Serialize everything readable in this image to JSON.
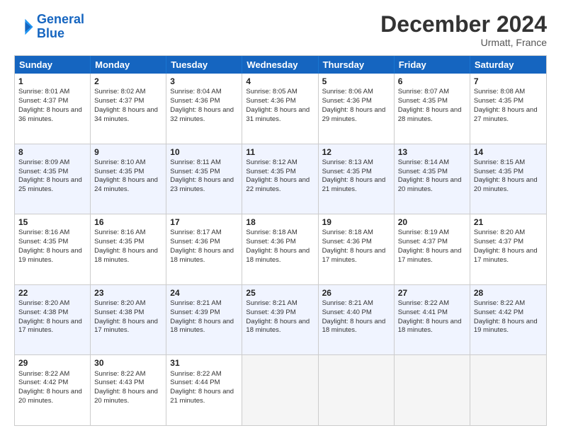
{
  "header": {
    "logo_line1": "General",
    "logo_line2": "Blue",
    "month_title": "December 2024",
    "location": "Urmatt, France"
  },
  "days_of_week": [
    "Sunday",
    "Monday",
    "Tuesday",
    "Wednesday",
    "Thursday",
    "Friday",
    "Saturday"
  ],
  "rows": [
    [
      {
        "day": "1",
        "sunrise": "Sunrise: 8:01 AM",
        "sunset": "Sunset: 4:37 PM",
        "daylight": "Daylight: 8 hours and 36 minutes."
      },
      {
        "day": "2",
        "sunrise": "Sunrise: 8:02 AM",
        "sunset": "Sunset: 4:37 PM",
        "daylight": "Daylight: 8 hours and 34 minutes."
      },
      {
        "day": "3",
        "sunrise": "Sunrise: 8:04 AM",
        "sunset": "Sunset: 4:36 PM",
        "daylight": "Daylight: 8 hours and 32 minutes."
      },
      {
        "day": "4",
        "sunrise": "Sunrise: 8:05 AM",
        "sunset": "Sunset: 4:36 PM",
        "daylight": "Daylight: 8 hours and 31 minutes."
      },
      {
        "day": "5",
        "sunrise": "Sunrise: 8:06 AM",
        "sunset": "Sunset: 4:36 PM",
        "daylight": "Daylight: 8 hours and 29 minutes."
      },
      {
        "day": "6",
        "sunrise": "Sunrise: 8:07 AM",
        "sunset": "Sunset: 4:35 PM",
        "daylight": "Daylight: 8 hours and 28 minutes."
      },
      {
        "day": "7",
        "sunrise": "Sunrise: 8:08 AM",
        "sunset": "Sunset: 4:35 PM",
        "daylight": "Daylight: 8 hours and 27 minutes."
      }
    ],
    [
      {
        "day": "8",
        "sunrise": "Sunrise: 8:09 AM",
        "sunset": "Sunset: 4:35 PM",
        "daylight": "Daylight: 8 hours and 25 minutes."
      },
      {
        "day": "9",
        "sunrise": "Sunrise: 8:10 AM",
        "sunset": "Sunset: 4:35 PM",
        "daylight": "Daylight: 8 hours and 24 minutes."
      },
      {
        "day": "10",
        "sunrise": "Sunrise: 8:11 AM",
        "sunset": "Sunset: 4:35 PM",
        "daylight": "Daylight: 8 hours and 23 minutes."
      },
      {
        "day": "11",
        "sunrise": "Sunrise: 8:12 AM",
        "sunset": "Sunset: 4:35 PM",
        "daylight": "Daylight: 8 hours and 22 minutes."
      },
      {
        "day": "12",
        "sunrise": "Sunrise: 8:13 AM",
        "sunset": "Sunset: 4:35 PM",
        "daylight": "Daylight: 8 hours and 21 minutes."
      },
      {
        "day": "13",
        "sunrise": "Sunrise: 8:14 AM",
        "sunset": "Sunset: 4:35 PM",
        "daylight": "Daylight: 8 hours and 20 minutes."
      },
      {
        "day": "14",
        "sunrise": "Sunrise: 8:15 AM",
        "sunset": "Sunset: 4:35 PM",
        "daylight": "Daylight: 8 hours and 20 minutes."
      }
    ],
    [
      {
        "day": "15",
        "sunrise": "Sunrise: 8:16 AM",
        "sunset": "Sunset: 4:35 PM",
        "daylight": "Daylight: 8 hours and 19 minutes."
      },
      {
        "day": "16",
        "sunrise": "Sunrise: 8:16 AM",
        "sunset": "Sunset: 4:35 PM",
        "daylight": "Daylight: 8 hours and 18 minutes."
      },
      {
        "day": "17",
        "sunrise": "Sunrise: 8:17 AM",
        "sunset": "Sunset: 4:36 PM",
        "daylight": "Daylight: 8 hours and 18 minutes."
      },
      {
        "day": "18",
        "sunrise": "Sunrise: 8:18 AM",
        "sunset": "Sunset: 4:36 PM",
        "daylight": "Daylight: 8 hours and 18 minutes."
      },
      {
        "day": "19",
        "sunrise": "Sunrise: 8:18 AM",
        "sunset": "Sunset: 4:36 PM",
        "daylight": "Daylight: 8 hours and 17 minutes."
      },
      {
        "day": "20",
        "sunrise": "Sunrise: 8:19 AM",
        "sunset": "Sunset: 4:37 PM",
        "daylight": "Daylight: 8 hours and 17 minutes."
      },
      {
        "day": "21",
        "sunrise": "Sunrise: 8:20 AM",
        "sunset": "Sunset: 4:37 PM",
        "daylight": "Daylight: 8 hours and 17 minutes."
      }
    ],
    [
      {
        "day": "22",
        "sunrise": "Sunrise: 8:20 AM",
        "sunset": "Sunset: 4:38 PM",
        "daylight": "Daylight: 8 hours and 17 minutes."
      },
      {
        "day": "23",
        "sunrise": "Sunrise: 8:20 AM",
        "sunset": "Sunset: 4:38 PM",
        "daylight": "Daylight: 8 hours and 17 minutes."
      },
      {
        "day": "24",
        "sunrise": "Sunrise: 8:21 AM",
        "sunset": "Sunset: 4:39 PM",
        "daylight": "Daylight: 8 hours and 18 minutes."
      },
      {
        "day": "25",
        "sunrise": "Sunrise: 8:21 AM",
        "sunset": "Sunset: 4:39 PM",
        "daylight": "Daylight: 8 hours and 18 minutes."
      },
      {
        "day": "26",
        "sunrise": "Sunrise: 8:21 AM",
        "sunset": "Sunset: 4:40 PM",
        "daylight": "Daylight: 8 hours and 18 minutes."
      },
      {
        "day": "27",
        "sunrise": "Sunrise: 8:22 AM",
        "sunset": "Sunset: 4:41 PM",
        "daylight": "Daylight: 8 hours and 18 minutes."
      },
      {
        "day": "28",
        "sunrise": "Sunrise: 8:22 AM",
        "sunset": "Sunset: 4:42 PM",
        "daylight": "Daylight: 8 hours and 19 minutes."
      }
    ],
    [
      {
        "day": "29",
        "sunrise": "Sunrise: 8:22 AM",
        "sunset": "Sunset: 4:42 PM",
        "daylight": "Daylight: 8 hours and 20 minutes."
      },
      {
        "day": "30",
        "sunrise": "Sunrise: 8:22 AM",
        "sunset": "Sunset: 4:43 PM",
        "daylight": "Daylight: 8 hours and 20 minutes."
      },
      {
        "day": "31",
        "sunrise": "Sunrise: 8:22 AM",
        "sunset": "Sunset: 4:44 PM",
        "daylight": "Daylight: 8 hours and 21 minutes."
      },
      null,
      null,
      null,
      null
    ]
  ],
  "row_alt": [
    false,
    true,
    false,
    true,
    false
  ]
}
